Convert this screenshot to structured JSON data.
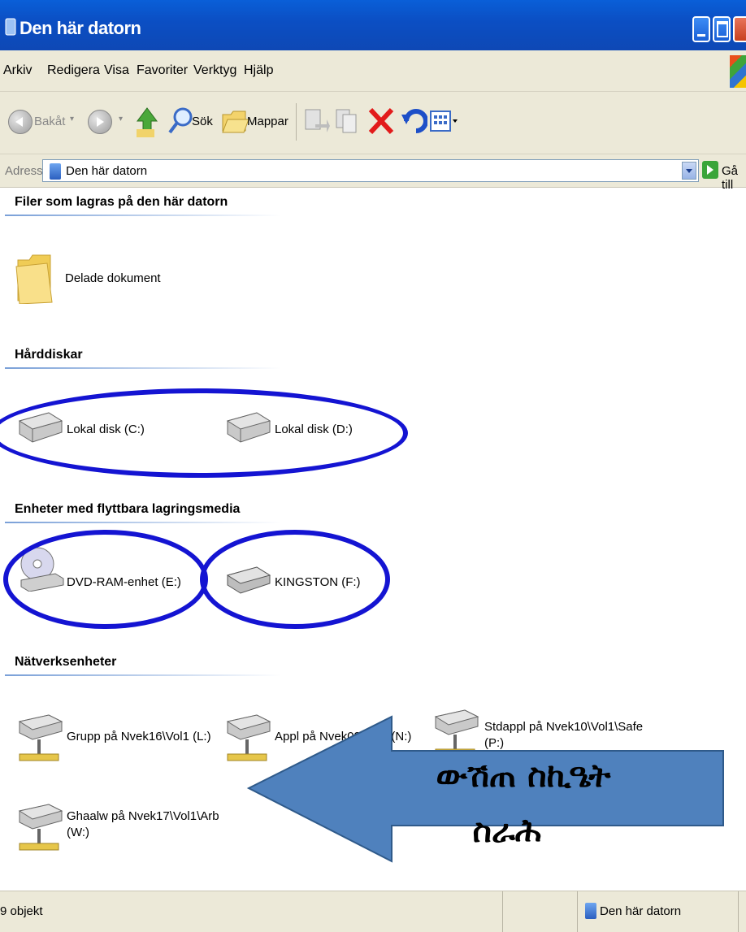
{
  "window": {
    "title": "Den här datorn"
  },
  "menu": [
    "Arkiv",
    "Redigera",
    "Visa",
    "Favoriter",
    "Verktyg",
    "Hjälp"
  ],
  "toolbar": {
    "back_label": "Bakåt",
    "search_label": "Sök",
    "folders_label": "Mappar"
  },
  "address": {
    "label": "Adress",
    "value": "Den här datorn",
    "go_label": "Gå till"
  },
  "sections": {
    "files": {
      "title": "Filer som lagras på den här datorn",
      "items": [
        "Delade dokument"
      ]
    },
    "harddisks": {
      "title": "Hårddiskar",
      "items": [
        "Lokal disk (C:)",
        "Lokal disk (D:)"
      ]
    },
    "removable": {
      "title": "Enheter med flyttbara lagringsmedia",
      "items": [
        "DVD-RAM-enhet (E:)",
        "KINGSTON (F:)"
      ]
    },
    "network": {
      "title": "Nätverksenheter",
      "items": [
        "Grupp på Nvek16\\Vol1 (L:)",
        "Appl på Nvek09\\Vol1 (N:)",
        "Stdappl på Nvek10\\Vol1\\Safe",
        "(P:)",
        "Ghaalw på Nvek17\\Vol1\\Arb",
        "(W:)"
      ]
    }
  },
  "annotation": {
    "line1": "ውሽጠ ስኪዔት",
    "line2": "ስራሕ",
    "arrow_color": "#4f81bd",
    "ellipse_color": "#1414d2"
  },
  "status": {
    "count": "9 objekt",
    "location": "Den här datorn"
  }
}
